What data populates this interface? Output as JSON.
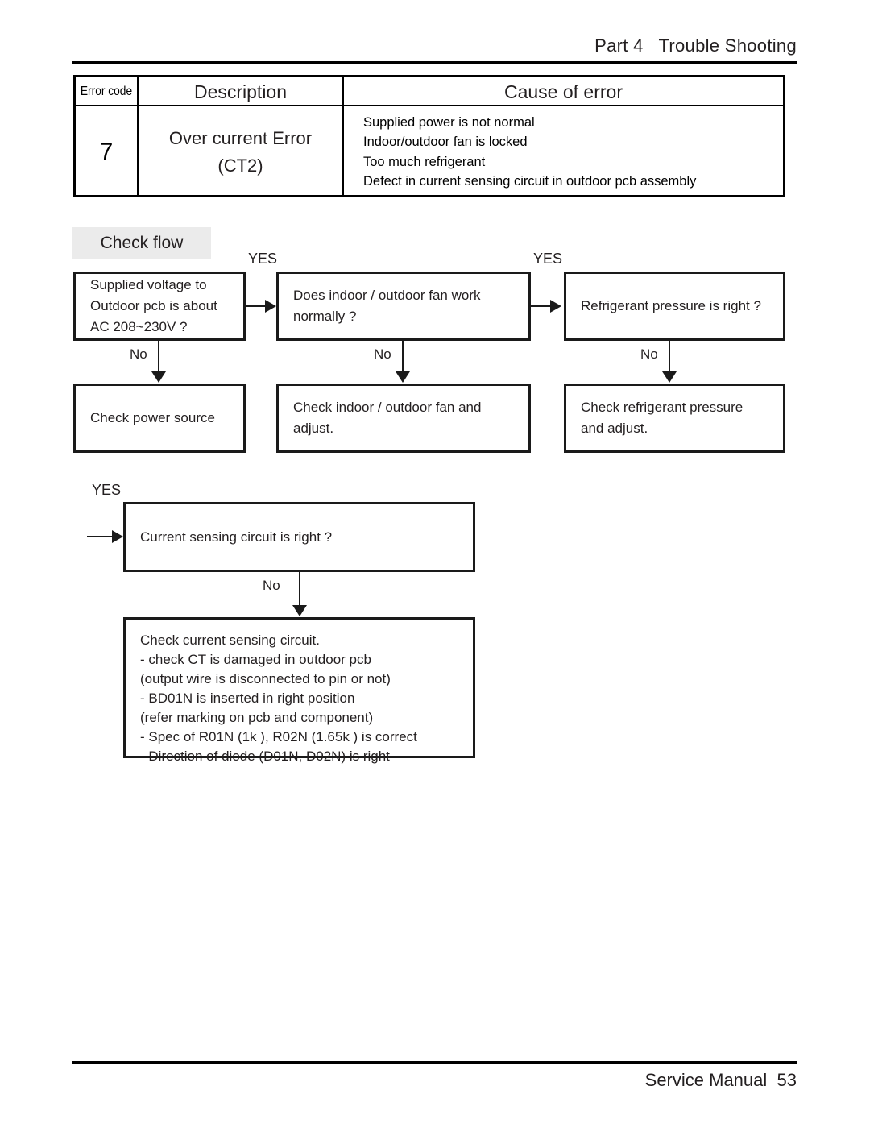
{
  "header": {
    "running_head": "Part 4   Trouble Shooting"
  },
  "error_table": {
    "headers": {
      "error_code": "Error code",
      "description": "Description",
      "cause_of_error": "Cause of error"
    },
    "row": {
      "code": "7",
      "description_line1": "Over current Error",
      "description_line2": "(CT2)",
      "causes": [
        "Supplied power is not normal",
        "Indoor/outdoor fan is locked",
        "Too much refrigerant",
        "Defect in current sensing circuit in outdoor pcb assembly"
      ]
    }
  },
  "check_flow": {
    "title": "Check flow",
    "labels": {
      "yes": "YES",
      "no": "No"
    },
    "boxes": {
      "q1": "Supplied voltage to\nOutdoor  pcb  is about\nAC 208~230V ?",
      "q2": "Does indoor / outdoor fan work\nnormally ?",
      "q3": "Refrigerant pressure is right ?",
      "a1": "Check power source",
      "a2": "Check indoor / outdoor fan and\nadjust.",
      "a3": "Check refrigerant pressure\nand adjust.",
      "q4": "Current sensing circuit is right ?",
      "a4": "Check current sensing circuit.\n- check CT is damaged in outdoor pcb\n   (output wire is disconnected to pin or not)\n- BD01N is inserted in right position\n   (refer marking on pcb and component)\n- Spec of R01N (1k   ), R02N (1.65k   ) is correct\n- Direction of diode (D01N, D02N) is right"
    }
  },
  "footer": {
    "manual_label": "Service Manual",
    "page_number": "53"
  }
}
